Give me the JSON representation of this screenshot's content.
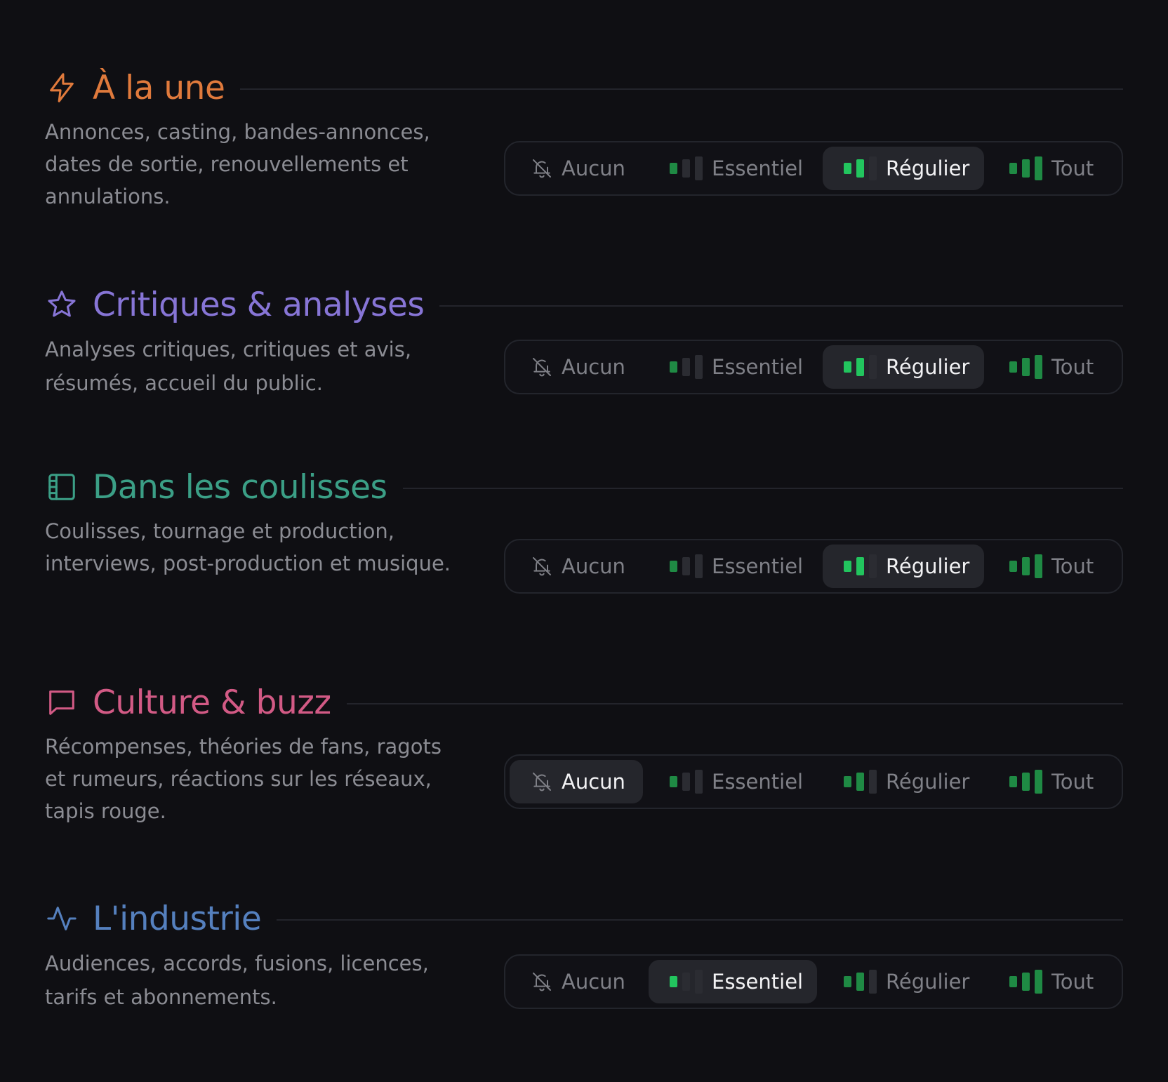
{
  "options": [
    "Aucun",
    "Essentiel",
    "Régulier",
    "Tout"
  ],
  "colors": {
    "background": "#0f0f13",
    "bar_off": "#2b2c32",
    "bar_on_dim": "#1f8a44",
    "bar_on_bright": "#22c55e"
  },
  "sections": [
    {
      "icon": "bolt-icon",
      "title": "À la une",
      "color": "#e07a3c",
      "description": "Annonces, casting, bandes-annonces, dates de sortie, renouvellements et annulations.",
      "selected": "Régulier"
    },
    {
      "icon": "star-icon",
      "title": "Critiques & analyses",
      "color": "#8775d6",
      "description": "Analyses critiques, critiques et avis, résumés, accueil du public.",
      "selected": "Régulier"
    },
    {
      "icon": "film-icon",
      "title": "Dans les coulisses",
      "color": "#3b9f86",
      "description": "Coulisses, tournage et production, interviews, post-production et musique.",
      "selected": "Régulier"
    },
    {
      "icon": "chat-bubble-icon",
      "title": "Culture & buzz",
      "color": "#d25a85",
      "description": "Récompenses, théories de fans, ragots et rumeurs, réactions sur les réseaux, tapis rouge.",
      "selected": "Aucun"
    },
    {
      "icon": "activity-icon",
      "title": "L'industrie",
      "color": "#5580be",
      "description": "Audiences, accords, fusions, licences, tarifs et abonnements.",
      "selected": "Essentiel"
    }
  ]
}
